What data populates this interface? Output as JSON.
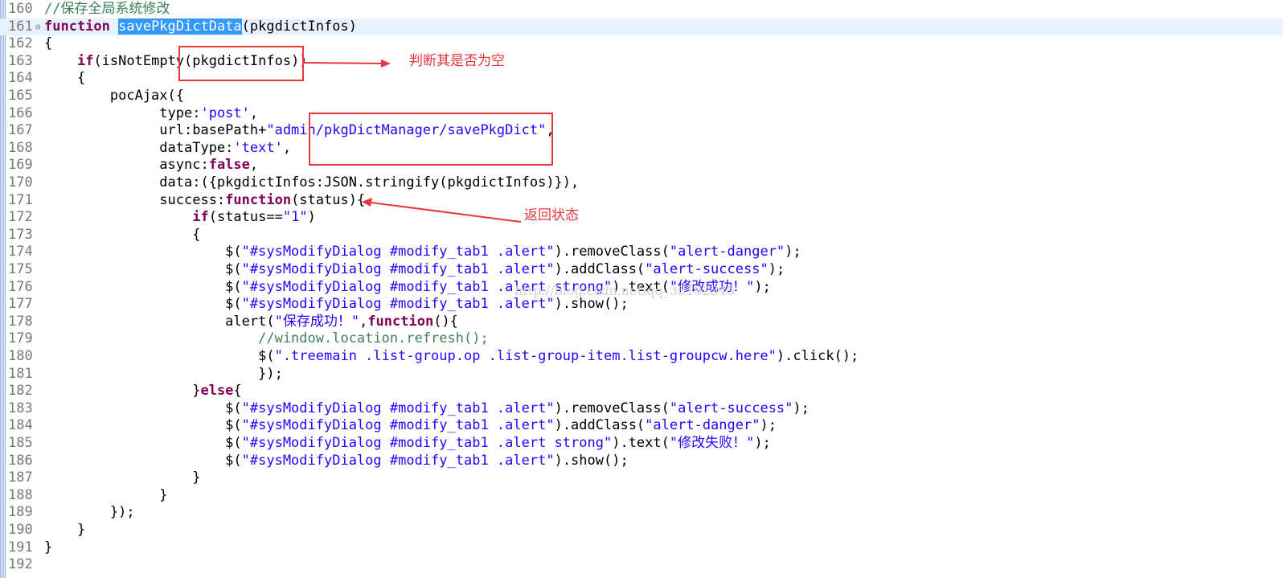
{
  "editor": {
    "lines": [
      {
        "num": "160",
        "tokens": [
          {
            "t": "//保存全局系统修改",
            "c": "cm"
          }
        ]
      },
      {
        "num": "161",
        "fold": "⊖",
        "current": true,
        "tokens": [
          {
            "t": "function",
            "c": "kw"
          },
          {
            "t": " "
          },
          {
            "t": "savePkgDictData",
            "c": "sel"
          },
          {
            "t": "(pkgdictInfos)"
          }
        ]
      },
      {
        "num": "162",
        "tokens": [
          {
            "t": "{"
          }
        ]
      },
      {
        "num": "163",
        "tokens": [
          {
            "t": "    "
          },
          {
            "t": "if",
            "c": "kw"
          },
          {
            "t": "(isNotEmpty(pkgdictInfos))"
          }
        ]
      },
      {
        "num": "164",
        "tokens": [
          {
            "t": "    {"
          }
        ]
      },
      {
        "num": "165",
        "tokens": [
          {
            "t": "        pocAjax({"
          }
        ]
      },
      {
        "num": "166",
        "tokens": [
          {
            "t": "              type:"
          },
          {
            "t": "'post'",
            "c": "str"
          },
          {
            "t": ","
          }
        ]
      },
      {
        "num": "167",
        "tokens": [
          {
            "t": "              url:basePath+"
          },
          {
            "t": "\"admin/pkgDictManager/savePkgDict\"",
            "c": "str"
          },
          {
            "t": ","
          }
        ]
      },
      {
        "num": "168",
        "tokens": [
          {
            "t": "              dataType:"
          },
          {
            "t": "'text'",
            "c": "str"
          },
          {
            "t": ","
          }
        ]
      },
      {
        "num": "169",
        "tokens": [
          {
            "t": "              async:"
          },
          {
            "t": "false",
            "c": "kw"
          },
          {
            "t": ","
          }
        ]
      },
      {
        "num": "170",
        "tokens": [
          {
            "t": "              data:({pkgdictInfos:JSON.stringify(pkgdictInfos)}),"
          }
        ]
      },
      {
        "num": "171",
        "tokens": [
          {
            "t": "              success:"
          },
          {
            "t": "function",
            "c": "kw"
          },
          {
            "t": "(status){"
          }
        ]
      },
      {
        "num": "172",
        "tokens": [
          {
            "t": "                  "
          },
          {
            "t": "if",
            "c": "kw"
          },
          {
            "t": "(status=="
          },
          {
            "t": "\"1\"",
            "c": "str"
          },
          {
            "t": ")"
          }
        ]
      },
      {
        "num": "173",
        "tokens": [
          {
            "t": "                  {"
          }
        ]
      },
      {
        "num": "174",
        "tokens": [
          {
            "t": "                      $("
          },
          {
            "t": "\"#sysModifyDialog #modify_tab1 .alert\"",
            "c": "str"
          },
          {
            "t": ").removeClass("
          },
          {
            "t": "\"alert-danger\"",
            "c": "str"
          },
          {
            "t": ");"
          }
        ]
      },
      {
        "num": "175",
        "tokens": [
          {
            "t": "                      $("
          },
          {
            "t": "\"#sysModifyDialog #modify_tab1 .alert\"",
            "c": "str"
          },
          {
            "t": ").addClass("
          },
          {
            "t": "\"alert-success\"",
            "c": "str"
          },
          {
            "t": ");"
          }
        ]
      },
      {
        "num": "176",
        "tokens": [
          {
            "t": "                      $("
          },
          {
            "t": "\"#sysModifyDialog #modify_tab1 .alert strong\"",
            "c": "str"
          },
          {
            "t": ").text("
          },
          {
            "t": "\"修改成功！\"",
            "c": "str"
          },
          {
            "t": ");"
          }
        ]
      },
      {
        "num": "177",
        "tokens": [
          {
            "t": "                      $("
          },
          {
            "t": "\"#sysModifyDialog #modify_tab1 .alert\"",
            "c": "str"
          },
          {
            "t": ").show();"
          }
        ]
      },
      {
        "num": "178",
        "tokens": [
          {
            "t": "                      alert("
          },
          {
            "t": "\"保存成功！\"",
            "c": "str"
          },
          {
            "t": ","
          },
          {
            "t": "function",
            "c": "kw"
          },
          {
            "t": "(){"
          }
        ]
      },
      {
        "num": "179",
        "tokens": [
          {
            "t": "                          "
          },
          {
            "t": "//window.location.refresh();",
            "c": "cm"
          }
        ]
      },
      {
        "num": "180",
        "tokens": [
          {
            "t": "                          $("
          },
          {
            "t": "\".treemain .list-group.op .list-group-item.list-groupcw.here\"",
            "c": "str"
          },
          {
            "t": ").click();"
          }
        ]
      },
      {
        "num": "181",
        "tokens": [
          {
            "t": "                          });"
          }
        ]
      },
      {
        "num": "182",
        "tokens": [
          {
            "t": "                  }"
          },
          {
            "t": "else",
            "c": "kw"
          },
          {
            "t": "{"
          }
        ]
      },
      {
        "num": "183",
        "tokens": [
          {
            "t": "                      $("
          },
          {
            "t": "\"#sysModifyDialog #modify_tab1 .alert\"",
            "c": "str"
          },
          {
            "t": ").removeClass("
          },
          {
            "t": "\"alert-success\"",
            "c": "str"
          },
          {
            "t": ");"
          }
        ]
      },
      {
        "num": "184",
        "tokens": [
          {
            "t": "                      $("
          },
          {
            "t": "\"#sysModifyDialog #modify_tab1 .alert\"",
            "c": "str"
          },
          {
            "t": ").addClass("
          },
          {
            "t": "\"alert-danger\"",
            "c": "str"
          },
          {
            "t": ");"
          }
        ]
      },
      {
        "num": "185",
        "tokens": [
          {
            "t": "                      $("
          },
          {
            "t": "\"#sysModifyDialog #modify_tab1 .alert strong\"",
            "c": "str"
          },
          {
            "t": ").text("
          },
          {
            "t": "\"修改失败！\"",
            "c": "str"
          },
          {
            "t": ");"
          }
        ]
      },
      {
        "num": "186",
        "tokens": [
          {
            "t": "                      $("
          },
          {
            "t": "\"#sysModifyDialog #modify_tab1 .alert\"",
            "c": "str"
          },
          {
            "t": ").show();"
          }
        ]
      },
      {
        "num": "187",
        "tokens": [
          {
            "t": "                  }"
          }
        ]
      },
      {
        "num": "188",
        "tokens": [
          {
            "t": "              }"
          }
        ]
      },
      {
        "num": "189",
        "tokens": [
          {
            "t": "        });"
          }
        ]
      },
      {
        "num": "190",
        "tokens": [
          {
            "t": "    }"
          }
        ]
      },
      {
        "num": "191",
        "tokens": [
          {
            "t": "}"
          }
        ]
      },
      {
        "num": "192",
        "tokens": []
      }
    ]
  },
  "annotations": {
    "empty_check_label": "判断其是否为空",
    "return_status_label": "返回状态"
  },
  "watermark": "http://blog.csdn.net/qq_35192345",
  "colors": {
    "keyword": "#7f0055",
    "string": "#2a00ff",
    "comment": "#3f7f5f",
    "selection": "#3399ff",
    "current_line": "#e8f2fe",
    "annotation": "#e8363a"
  }
}
